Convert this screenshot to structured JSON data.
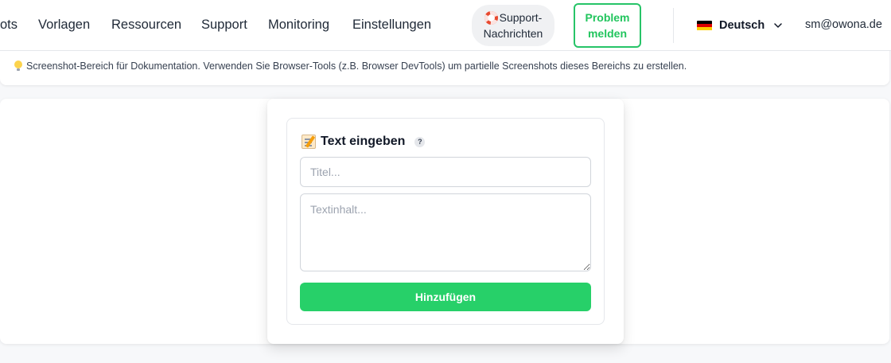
{
  "nav": {
    "items": [
      {
        "label": "ots"
      },
      {
        "label": "Vorlagen"
      },
      {
        "label": "Ressourcen"
      },
      {
        "label": "Support"
      },
      {
        "label": "Monitoring"
      },
      {
        "label": "Einstellungen"
      }
    ],
    "support_messages": {
      "line1": "Support-",
      "line2": "Nachrichten",
      "icon": "lifebuoy-icon"
    },
    "report_problem": {
      "line1": "Problem",
      "line2": "melden"
    },
    "language": {
      "label": "Deutsch",
      "flag": "germany-flag-icon"
    },
    "user_email": "sm@owona.de"
  },
  "info": {
    "icon": "lightbulb-icon",
    "text": "Screenshot-Bereich für Dokumentation. Verwenden Sie Browser-Tools (z.B. Browser DevTools) um partielle Screenshots dieses Bereichs zu erstellen."
  },
  "text_card": {
    "icon": "memo-icon",
    "title": "Text eingeben",
    "help": "?",
    "title_placeholder": "Titel...",
    "content_placeholder": "Textinhalt...",
    "submit_label": "Hinzufügen"
  },
  "colors": {
    "accent": "#27d069",
    "accent_border": "#27c468",
    "flag": [
      "#000000",
      "#dd0000",
      "#ffce00"
    ]
  }
}
